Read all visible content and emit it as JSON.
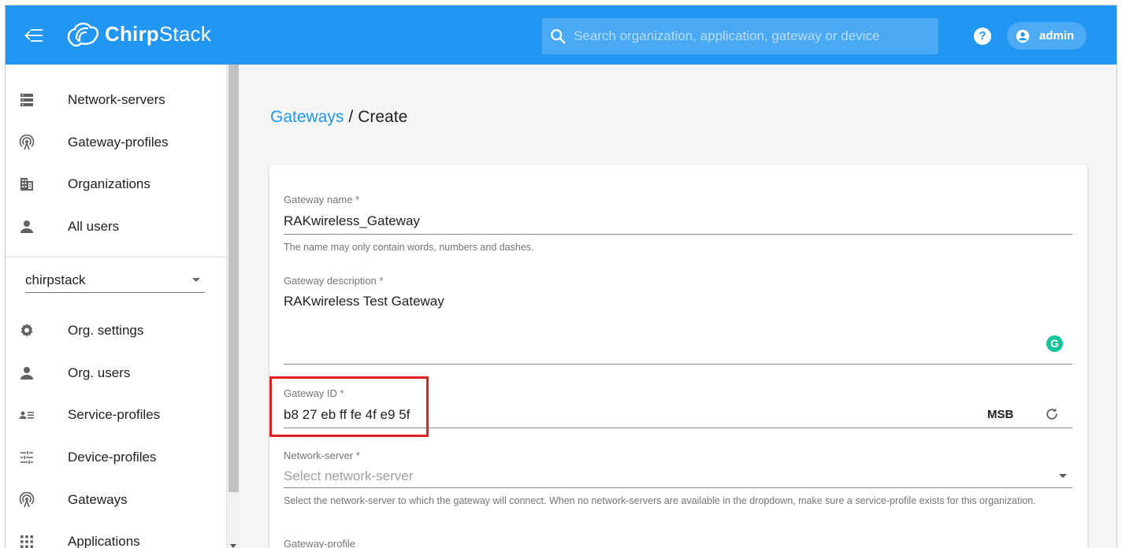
{
  "header": {
    "logo_text_bold": "Chirp",
    "logo_text_regular": "Stack",
    "search_placeholder": "Search organization, application, gateway or device",
    "help_label": "?",
    "user": "admin"
  },
  "sidebar": {
    "top_items": [
      {
        "label": "Network-servers",
        "icon": "server-icon"
      },
      {
        "label": "Gateway-profiles",
        "icon": "gateway-antenna-icon"
      },
      {
        "label": "Organizations",
        "icon": "building-icon"
      },
      {
        "label": "All users",
        "icon": "person-icon"
      }
    ],
    "org_select_value": "chirpstack",
    "org_items": [
      {
        "label": "Org. settings",
        "icon": "gear-icon"
      },
      {
        "label": "Org. users",
        "icon": "person-icon"
      },
      {
        "label": "Service-profiles",
        "icon": "account-details-icon"
      },
      {
        "label": "Device-profiles",
        "icon": "tune-icon"
      },
      {
        "label": "Gateways",
        "icon": "gateway-antenna-icon"
      },
      {
        "label": "Applications",
        "icon": "apps-grid-icon"
      }
    ]
  },
  "breadcrumb": {
    "link": "Gateways",
    "separator": "/",
    "current": "Create"
  },
  "form": {
    "name_label": "Gateway name *",
    "name_value": "RAKwireless_Gateway",
    "name_helper": "The name may only contain words, numbers and dashes.",
    "description_label": "Gateway description *",
    "description_value": "RAKwireless Test Gateway",
    "grammarly_label": "G",
    "id_label": "Gateway ID *",
    "id_value": "b8 27 eb ff fe 4f e9 5f",
    "id_byte_order": "MSB",
    "network_server_label": "Network-server *",
    "network_server_placeholder": "Select network-server",
    "network_server_helper": "Select the network-server to which the gateway will connect. When no network-servers are available in the dropdown, make sure a service-profile exists for this organization.",
    "gateway_profile_label": "Gateway-profile"
  },
  "colors": {
    "primary": "#2196f3",
    "highlight": "#e02020",
    "grammarly": "#15c39a"
  }
}
